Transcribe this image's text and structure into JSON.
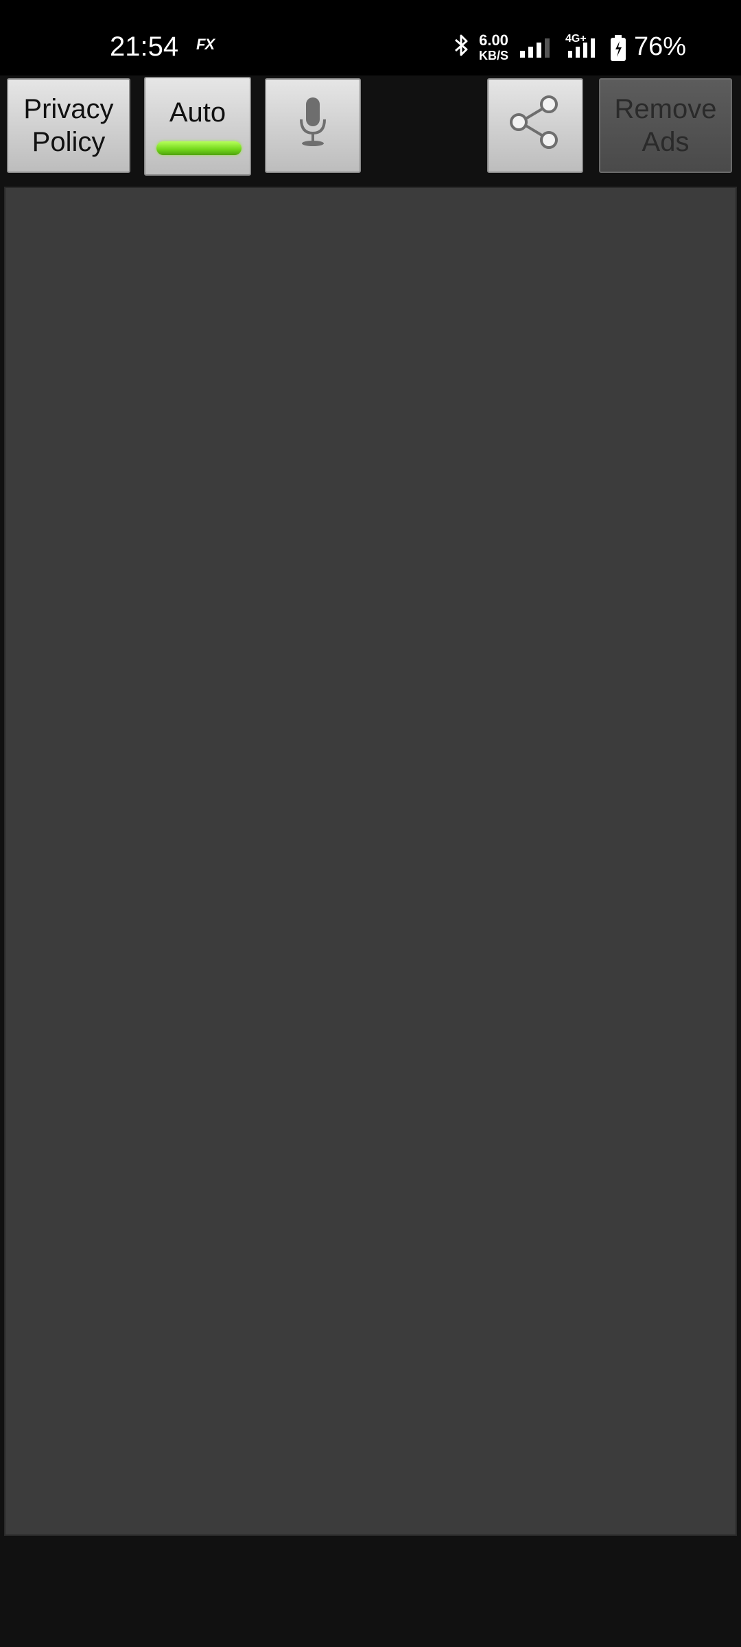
{
  "status_bar": {
    "time": "21:54",
    "app_badge": "FX",
    "net_speed_value": "6.00",
    "net_speed_unit": "KB/S",
    "network_type": "4G+",
    "battery_percent": "76%"
  },
  "toolbar": {
    "privacy_line1": "Privacy",
    "privacy_line2": "Policy",
    "auto_label": "Auto",
    "auto_indicator_color": "#7ed321",
    "remove_line1": "Remove",
    "remove_line2": "Ads"
  },
  "icons": {
    "mic": "microphone-icon",
    "share": "share-icon"
  },
  "colors": {
    "panel": "#3c3c3c",
    "background": "#111111",
    "button_face": "#d6d6d6"
  }
}
